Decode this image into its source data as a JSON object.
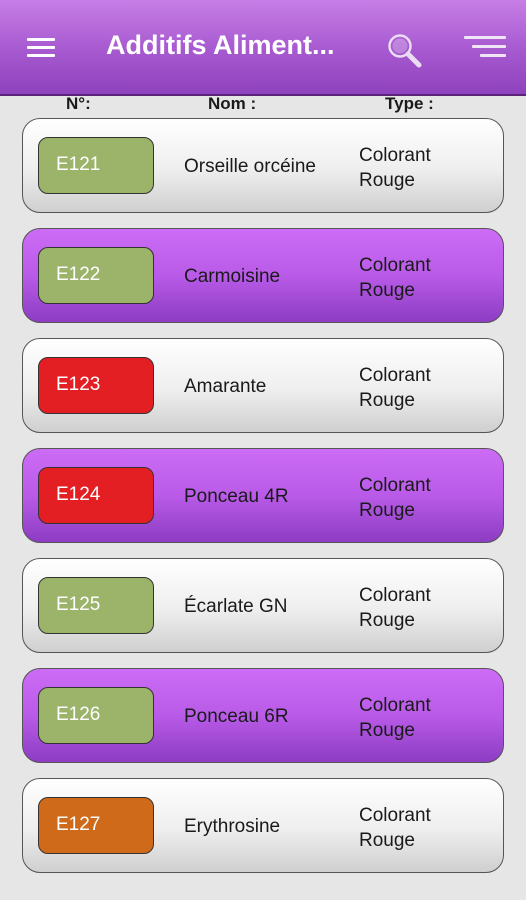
{
  "appbar": {
    "title": "Additifs Aliment...",
    "menu_icon": "hamburger-menu-icon",
    "search_icon": "search-icon",
    "sort_icon": "sort-icon",
    "gradient_top": "#c77ee6",
    "gradient_bottom": "#8e42bd"
  },
  "headers": {
    "number": "N°:",
    "name": "Nom :",
    "type": "Type :"
  },
  "colors": {
    "green": "#9cb36a",
    "red": "#e31f24",
    "orange": "#cf6a1a",
    "row_purple": "#b95be8",
    "row_light": "#eeeeee"
  },
  "additives": [
    {
      "code": "E121",
      "name": "Orseille orcéine",
      "type_line1": "Colorant",
      "type_line2": "Rouge",
      "badge": "green",
      "row": "light"
    },
    {
      "code": "E122",
      "name": "Carmoisine",
      "type_line1": "Colorant",
      "type_line2": "Rouge",
      "badge": "green",
      "row": "purple"
    },
    {
      "code": "E123",
      "name": "Amarante",
      "type_line1": "Colorant",
      "type_line2": "Rouge",
      "badge": "red",
      "row": "light"
    },
    {
      "code": "E124",
      "name": "Ponceau 4R",
      "type_line1": "Colorant",
      "type_line2": "Rouge",
      "badge": "red",
      "row": "purple"
    },
    {
      "code": "E125",
      "name": "Écarlate GN",
      "type_line1": "Colorant",
      "type_line2": "Rouge",
      "badge": "green",
      "row": "light"
    },
    {
      "code": "E126",
      "name": "Ponceau 6R",
      "type_line1": "Colorant",
      "type_line2": "Rouge",
      "badge": "green",
      "row": "purple"
    },
    {
      "code": "E127",
      "name": "Erythrosine",
      "type_line1": "Colorant",
      "type_line2": "Rouge",
      "badge": "orange",
      "row": "light"
    }
  ]
}
